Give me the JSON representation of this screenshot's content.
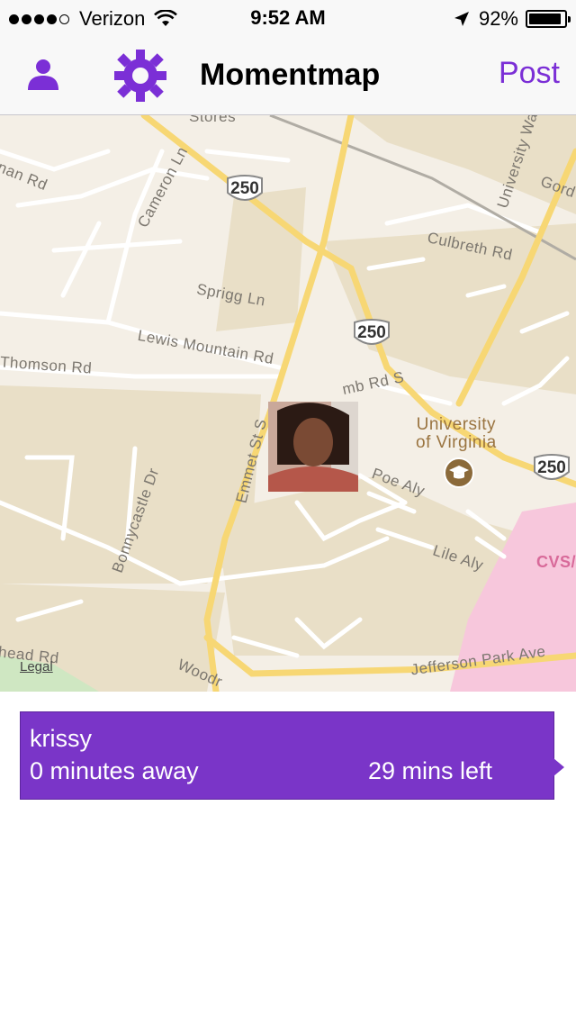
{
  "status_bar": {
    "carrier": "Verizon",
    "signal_bars": 4,
    "signal_max": 5,
    "time": "9:52 AM",
    "battery_percent": "92%",
    "battery_level": 0.92
  },
  "nav": {
    "title": "Momentmap",
    "post_label": "Post",
    "icons": [
      "profile-icon",
      "gear-icon"
    ],
    "accent": "#7b2fd6"
  },
  "map": {
    "labels": {
      "stores": "Stores",
      "man_rd": "nan Rd",
      "cameron_ln": "Cameron Ln",
      "sprigg_ln": "Sprigg Ln",
      "lewis_mountain_rd": "Lewis Mountain Rd",
      "thomson_rd": "Thomson Rd",
      "culbreth_rd": "Culbreth Rd",
      "university_way": "University Wa",
      "gord": "Gord",
      "emmet_st": "Emmet St S",
      "mb_rd": "mb Rd S",
      "university_line1": "University",
      "university_line2": "of Virginia",
      "poe_aly": "Poe Aly",
      "lile_aly": "Lile Aly",
      "bonnycastle_dr": "Bonnycastle Dr",
      "cvs": "CVS/",
      "head_rd": "head Rd",
      "woodr": "Woodr",
      "jefferson_park_ave": "Jefferson Park Ave"
    },
    "shields": [
      "250",
      "250",
      "250"
    ],
    "legal": "Legal",
    "colors": {
      "land": "#f4efe6",
      "block": "#e9dfc7",
      "road": "#ffffff",
      "arterial": "#f7d774",
      "park": "#cfe7c2",
      "pink": "#f7c7dc"
    }
  },
  "card": {
    "name": "krissy",
    "distance": "0 minutes away",
    "time_left": "29 mins left",
    "color": "#7a35c8"
  }
}
